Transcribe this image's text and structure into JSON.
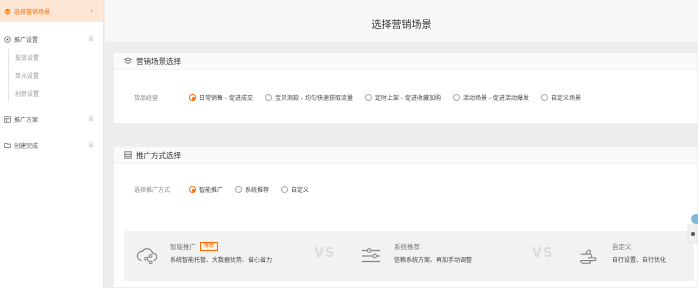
{
  "sidebar": {
    "active": {
      "label": "选择营销场景",
      "icon": "layers-icon"
    },
    "items": [
      {
        "label": "推广设置",
        "icon": "gear-circle-icon",
        "locked": true,
        "subitems": [
          "投放设置",
          "单元设置",
          "创意设置"
        ]
      },
      {
        "label": "推广方案",
        "icon": "table-icon",
        "locked": true
      },
      {
        "label": "创建完成",
        "icon": "folder-icon",
        "locked": true
      }
    ]
  },
  "main": {
    "title": "选择营销场景",
    "scene_panel": {
      "heading": "营销场景选择",
      "label": "货品经营",
      "options": [
        "日常销售 - 促进成交",
        "宝贝测款 - 均匀快速获取流量",
        "定时上架 - 促进收藏加购",
        "活动场景 - 促进活动爆发",
        "自定义场景"
      ],
      "selected_index": 0
    },
    "method_panel": {
      "heading": "推广方式选择",
      "label": "选择推广方式",
      "options": [
        "智能推广",
        "系统推荐",
        "自定义"
      ],
      "selected_index": 0,
      "modes": [
        {
          "title": "智能推广",
          "tag": "推荐",
          "desc": "系统智能托管、大数据优势、省心省力",
          "icon": "cloud-share-icon"
        },
        {
          "title": "系统推荐",
          "desc": "信赖系统方案、再加手动调整",
          "icon": "sliders-icon"
        },
        {
          "title": "自定义",
          "desc": "自行设置、自行优化",
          "icon": "hand-point-icon"
        }
      ],
      "vs_label": "VS"
    }
  },
  "colors": {
    "accent": "#ff6a00",
    "active_bg": "#fde6d4"
  }
}
